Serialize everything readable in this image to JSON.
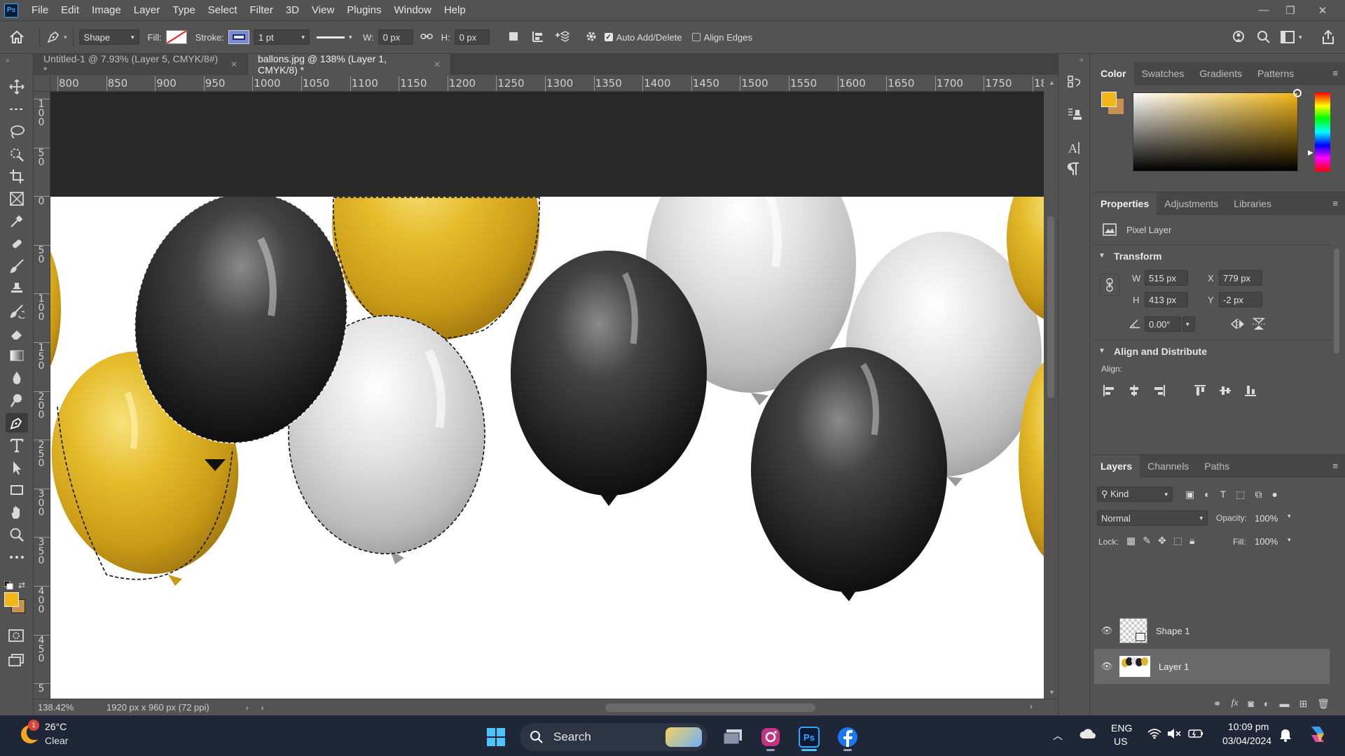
{
  "app": {
    "logo": "Ps"
  },
  "menu": [
    "File",
    "Edit",
    "Image",
    "Layer",
    "Type",
    "Select",
    "Filter",
    "3D",
    "View",
    "Plugins",
    "Window",
    "Help"
  ],
  "window_controls": {
    "minimize": "—",
    "restore": "❐",
    "close": "✕"
  },
  "options": {
    "mode": "Shape",
    "fill_label": "Fill:",
    "stroke_label": "Stroke:",
    "stroke_size": "1 pt",
    "w_label": "W:",
    "w_value": "0 px",
    "h_label": "H:",
    "h_value": "0 px",
    "auto_add_delete": "Auto Add/Delete",
    "auto_add_delete_checked": true,
    "align_edges": "Align Edges",
    "align_edges_checked": false
  },
  "tabs": [
    {
      "label": "Untitled-1 @ 7.93% (Layer 5, CMYK/8#) *",
      "active": false
    },
    {
      "label": "ballons.jpg @ 138% (Layer 1, CMYK/8) *",
      "active": true
    }
  ],
  "ruler": {
    "top": [
      "800",
      "850",
      "900",
      "950",
      "1000",
      "1050",
      "1100",
      "1150",
      "1200",
      "1250",
      "1300",
      "1350",
      "1400",
      "1450",
      "1500",
      "1550",
      "1600",
      "1650",
      "1700",
      "1750",
      "18"
    ],
    "left": [
      "100",
      "50",
      "0",
      "50",
      "100",
      "150",
      "200",
      "250",
      "300",
      "350",
      "400",
      "450",
      "5"
    ]
  },
  "status": {
    "zoom": "138.42%",
    "doc_size": "1920 px x 960 px (72 ppi)"
  },
  "color_panel": {
    "tabs": [
      "Color",
      "Swatches",
      "Gradients",
      "Patterns"
    ],
    "foreground": "#f2b718",
    "background": "#c8924e"
  },
  "properties": {
    "tabs": [
      "Properties",
      "Adjustments",
      "Libraries"
    ],
    "kind": "Pixel Layer",
    "transform_title": "Transform",
    "w_label": "W",
    "w": "515 px",
    "x_label": "X",
    "x": "779 px",
    "h_label": "H",
    "h": "413 px",
    "y_label": "Y",
    "y": "-2 px",
    "angle": "0.00°",
    "align_title": "Align and Distribute",
    "align_label": "Align:"
  },
  "layers_panel": {
    "tabs": [
      "Layers",
      "Channels",
      "Paths"
    ],
    "kind": "Kind",
    "blend_mode": "Normal",
    "opacity_label": "Opacity:",
    "opacity": "100%",
    "lock_label": "Lock:",
    "fill_label": "Fill:",
    "fill": "100%",
    "layers": [
      {
        "name": "Shape 1",
        "selected": false
      },
      {
        "name": "Layer 1",
        "selected": true
      }
    ]
  },
  "taskbar": {
    "weather_temp": "26°C",
    "weather_desc": "Clear",
    "weather_badge": "1",
    "search": "Search",
    "lang_top": "ENG",
    "lang_bottom": "US",
    "time": "10:09 pm",
    "date": "03/04/2024"
  }
}
